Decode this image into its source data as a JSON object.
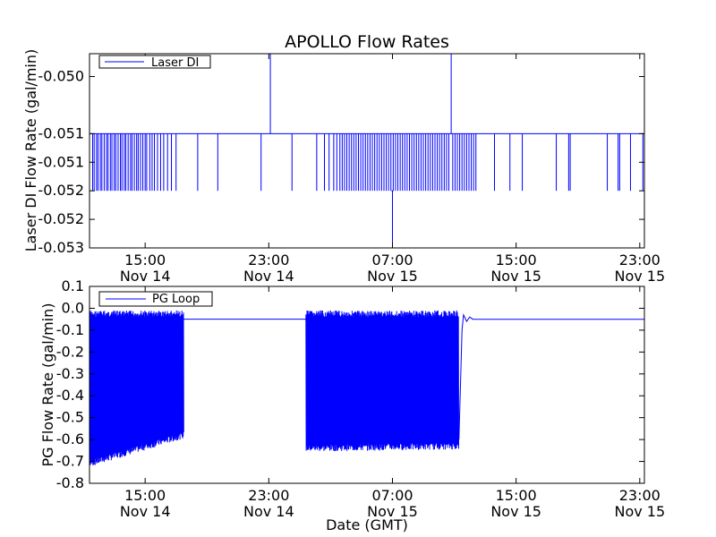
{
  "chart_data": {
    "title": "APOLLO Flow Rates",
    "xlabel": "Date (GMT)",
    "x_ticks": [
      {
        "time": "15:00",
        "date": "Nov 14",
        "hour": 15
      },
      {
        "time": "23:00",
        "date": "Nov 14",
        "hour": 23
      },
      {
        "time": "07:00",
        "date": "Nov 15",
        "hour": 31
      },
      {
        "time": "15:00",
        "date": "Nov 15",
        "hour": 39
      },
      {
        "time": "23:00",
        "date": "Nov 15",
        "hour": 47
      }
    ],
    "xlim_hours_from_nov14_0000": [
      11.4,
      47.3
    ],
    "line_color": "#0000ff",
    "charts": [
      {
        "type": "line",
        "ylabel": "Laser DI Flow Rate (gal/min)",
        "ylim": [
          -0.053,
          -0.0496
        ],
        "y_ticks": [
          {
            "value": -0.05,
            "label": "-0.050"
          },
          {
            "value": -0.051,
            "label": "-0.051"
          },
          {
            "value": -0.0515,
            "label": "-0.051"
          },
          {
            "value": -0.052,
            "label": "-0.052"
          },
          {
            "value": -0.0525,
            "label": "-0.052"
          },
          {
            "value": -0.053,
            "label": "-0.053"
          }
        ],
        "legend": {
          "label": "Laser DI",
          "loc": "upper-left"
        },
        "series": [
          {
            "name": "Laser DI",
            "baseline": -0.051,
            "drop_level": -0.052,
            "spike_level": -0.0496,
            "dip_level": -0.053,
            "spikes_hour": [
              23.1,
              34.8
            ],
            "dip_hour": [
              31.0
            ],
            "drops_hour": [
              11.6,
              11.7,
              11.85,
              11.95,
              12.1,
              12.2,
              12.35,
              12.5,
              12.6,
              12.75,
              12.85,
              13.0,
              13.1,
              13.25,
              13.4,
              13.5,
              13.65,
              13.75,
              13.9,
              14.05,
              14.15,
              14.3,
              14.45,
              14.55,
              14.7,
              14.85,
              15.0,
              15.1,
              15.3,
              15.45,
              15.6,
              15.8,
              16.0,
              16.2,
              16.45,
              16.7,
              17.0,
              18.4,
              19.7,
              22.5,
              24.5,
              26.1,
              26.6,
              26.9,
              27.2,
              27.4,
              27.6,
              27.75,
              27.9,
              28.05,
              28.2,
              28.35,
              28.5,
              28.65,
              28.8,
              28.95,
              29.1,
              29.25,
              29.4,
              29.55,
              29.7,
              29.85,
              30.0,
              30.15,
              30.3,
              30.45,
              30.6,
              30.75,
              30.9,
              31.05,
              31.2,
              31.35,
              31.5,
              31.65,
              31.8,
              31.95,
              32.1,
              32.25,
              32.4,
              32.55,
              32.7,
              32.85,
              33.0,
              33.15,
              33.3,
              33.45,
              33.6,
              33.75,
              33.9,
              34.05,
              34.2,
              34.35,
              34.5,
              34.65,
              34.9,
              35.05,
              35.2,
              35.35,
              35.5,
              35.65,
              35.8,
              35.95,
              36.1,
              36.25,
              36.4,
              37.6,
              38.6,
              39.4,
              41.6,
              42.4,
              42.5,
              44.9,
              45.6,
              45.7,
              46.4,
              47.2
            ]
          }
        ]
      },
      {
        "type": "line",
        "ylabel": "PG Flow Rate (gal/min)",
        "ylim": [
          -0.8,
          0.1
        ],
        "y_ticks": [
          {
            "value": 0.1,
            "label": "0.1"
          },
          {
            "value": 0.0,
            "label": "0.0"
          },
          {
            "value": -0.1,
            "label": "-0.1"
          },
          {
            "value": -0.2,
            "label": "-0.2"
          },
          {
            "value": -0.3,
            "label": "-0.3"
          },
          {
            "value": -0.4,
            "label": "-0.4"
          },
          {
            "value": -0.5,
            "label": "-0.5"
          },
          {
            "value": -0.6,
            "label": "-0.6"
          },
          {
            "value": -0.7,
            "label": "-0.7"
          },
          {
            "value": -0.8,
            "label": "-0.8"
          }
        ],
        "legend": {
          "label": "PG Loop",
          "loc": "upper-left"
        },
        "series": [
          {
            "name": "PG Loop",
            "baseline": -0.05,
            "oscillation_segments": [
              {
                "start_hour": 11.4,
                "end_hour": 17.5,
                "high": -0.01,
                "low_start": -0.71,
                "low_end": -0.58
              },
              {
                "start_hour": 25.4,
                "end_hour": 35.3,
                "high": -0.01,
                "low_start": -0.64,
                "low_end": -0.63
              }
            ],
            "tail_points": [
              [
                35.3,
                -0.6
              ],
              [
                35.4,
                -0.35
              ],
              [
                35.5,
                -0.1
              ],
              [
                35.6,
                -0.03
              ],
              [
                35.8,
                -0.06
              ],
              [
                36.0,
                -0.04
              ],
              [
                36.2,
                -0.05
              ],
              [
                36.5,
                -0.05
              ],
              [
                37.0,
                -0.05
              ]
            ]
          }
        ]
      }
    ]
  }
}
